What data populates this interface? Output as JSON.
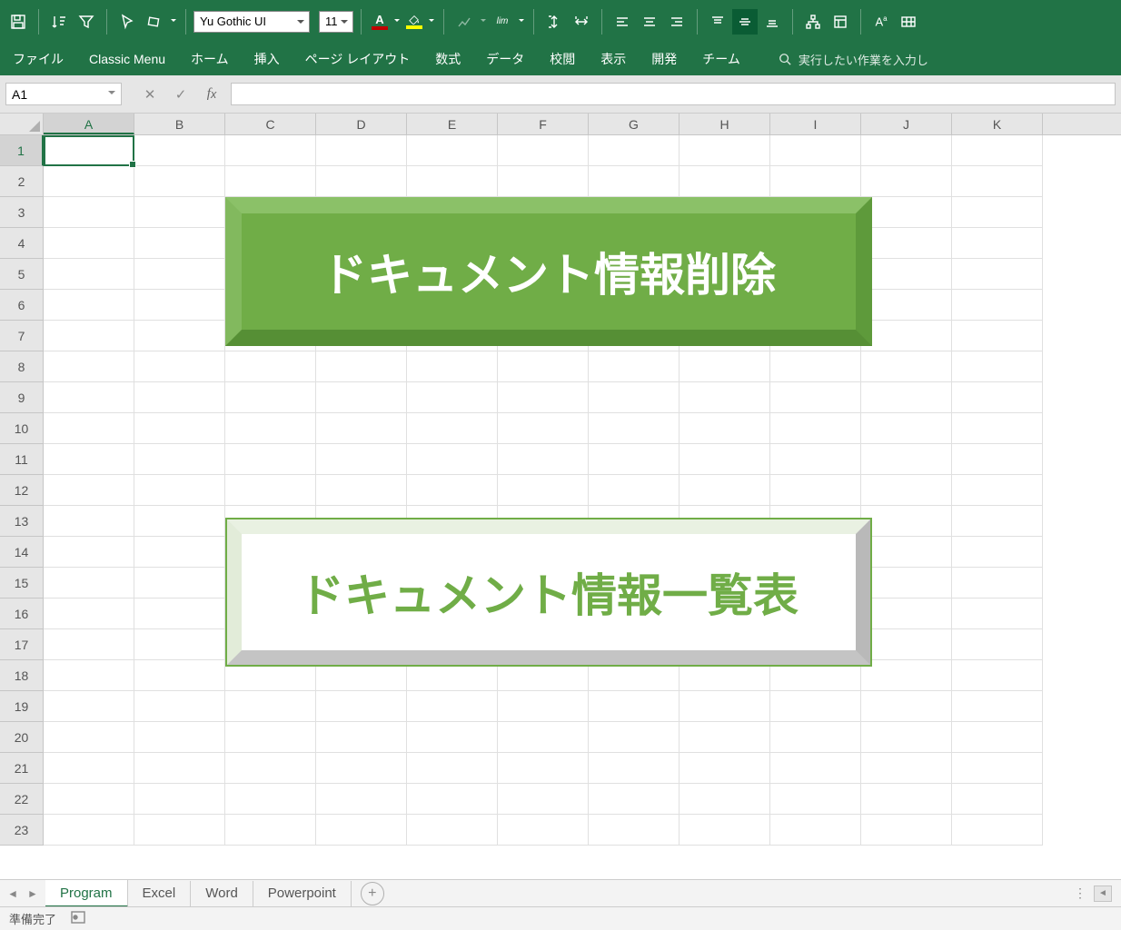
{
  "toolbar": {
    "font_name": "Yu Gothic UI",
    "font_size": "11",
    "font_color": "#c00000",
    "fill_color": "#ffff00"
  },
  "tabs": {
    "file": "ファイル",
    "classic": "Classic Menu",
    "home": "ホーム",
    "insert": "挿入",
    "page_layout": "ページ レイアウト",
    "formulas": "数式",
    "data": "データ",
    "review": "校閲",
    "view": "表示",
    "developer": "開発",
    "team": "チーム",
    "tell_me": "実行したい作業を入力し"
  },
  "name_box": "A1",
  "formula_value": "",
  "columns": [
    "A",
    "B",
    "C",
    "D",
    "E",
    "F",
    "G",
    "H",
    "I",
    "J",
    "K"
  ],
  "rows": [
    "1",
    "2",
    "3",
    "4",
    "5",
    "6",
    "7",
    "8",
    "9",
    "10",
    "11",
    "12",
    "13",
    "14",
    "15",
    "16",
    "17",
    "18",
    "19",
    "20",
    "21",
    "22",
    "23"
  ],
  "active_col": "A",
  "active_row": "1",
  "buttons": {
    "delete_doc_info": "ドキュメント情報削除",
    "doc_info_list": "ドキュメント情報一覧表"
  },
  "sheet_tabs": {
    "program": "Program",
    "excel": "Excel",
    "word": "Word",
    "powerpoint": "Powerpoint"
  },
  "status": {
    "ready": "準備完了"
  }
}
